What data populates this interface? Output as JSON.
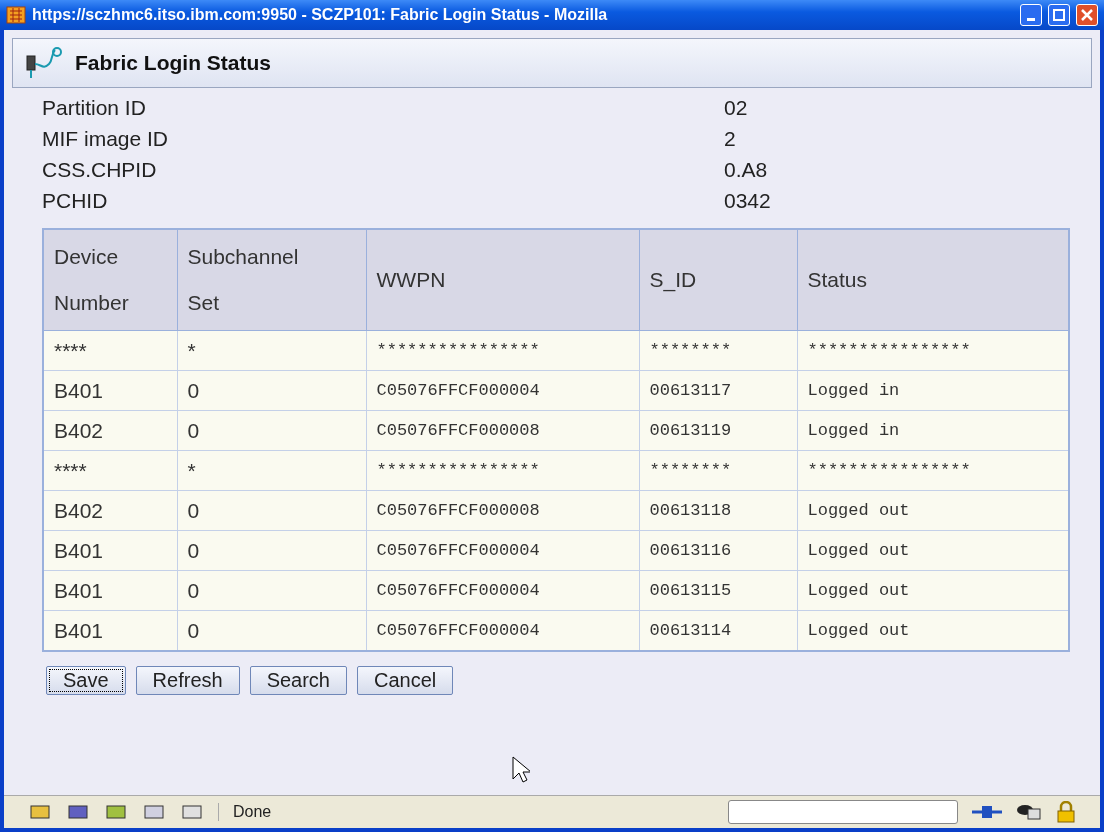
{
  "window": {
    "title": "https://sczhmc6.itso.ibm.com:9950 - SCZP101: Fabric Login Status - Mozilla"
  },
  "header": {
    "title": "Fabric Login Status"
  },
  "info": [
    {
      "label": "Partition ID",
      "value": "02"
    },
    {
      "label": "MIF image ID",
      "value": "2"
    },
    {
      "label": "CSS.CHPID",
      "value": "0.A8"
    },
    {
      "label": "PCHID",
      "value": "0342"
    }
  ],
  "table": {
    "columns": [
      "Device Number",
      "Subchannel Set",
      "WWPN",
      "S_ID",
      "Status"
    ],
    "rows": [
      [
        "****",
        "*",
        "****************",
        "********",
        "****************"
      ],
      [
        "B401",
        "0",
        "C05076FFCF000004",
        "00613117",
        "Logged in"
      ],
      [
        "B402",
        "0",
        "C05076FFCF000008",
        "00613119",
        "Logged in"
      ],
      [
        "****",
        "*",
        "****************",
        "********",
        "****************"
      ],
      [
        "B402",
        "0",
        "C05076FFCF000008",
        "00613118",
        "Logged out"
      ],
      [
        "B401",
        "0",
        "C05076FFCF000004",
        "00613116",
        "Logged out"
      ],
      [
        "B401",
        "0",
        "C05076FFCF000004",
        "00613115",
        "Logged out"
      ],
      [
        "B401",
        "0",
        "C05076FFCF000004",
        "00613114",
        "Logged out"
      ]
    ]
  },
  "buttons": [
    {
      "label": "Save",
      "focused": true
    },
    {
      "label": "Refresh",
      "focused": false
    },
    {
      "label": "Search",
      "focused": false
    },
    {
      "label": "Cancel",
      "focused": false
    }
  ],
  "status_bar": {
    "text": "Done"
  }
}
